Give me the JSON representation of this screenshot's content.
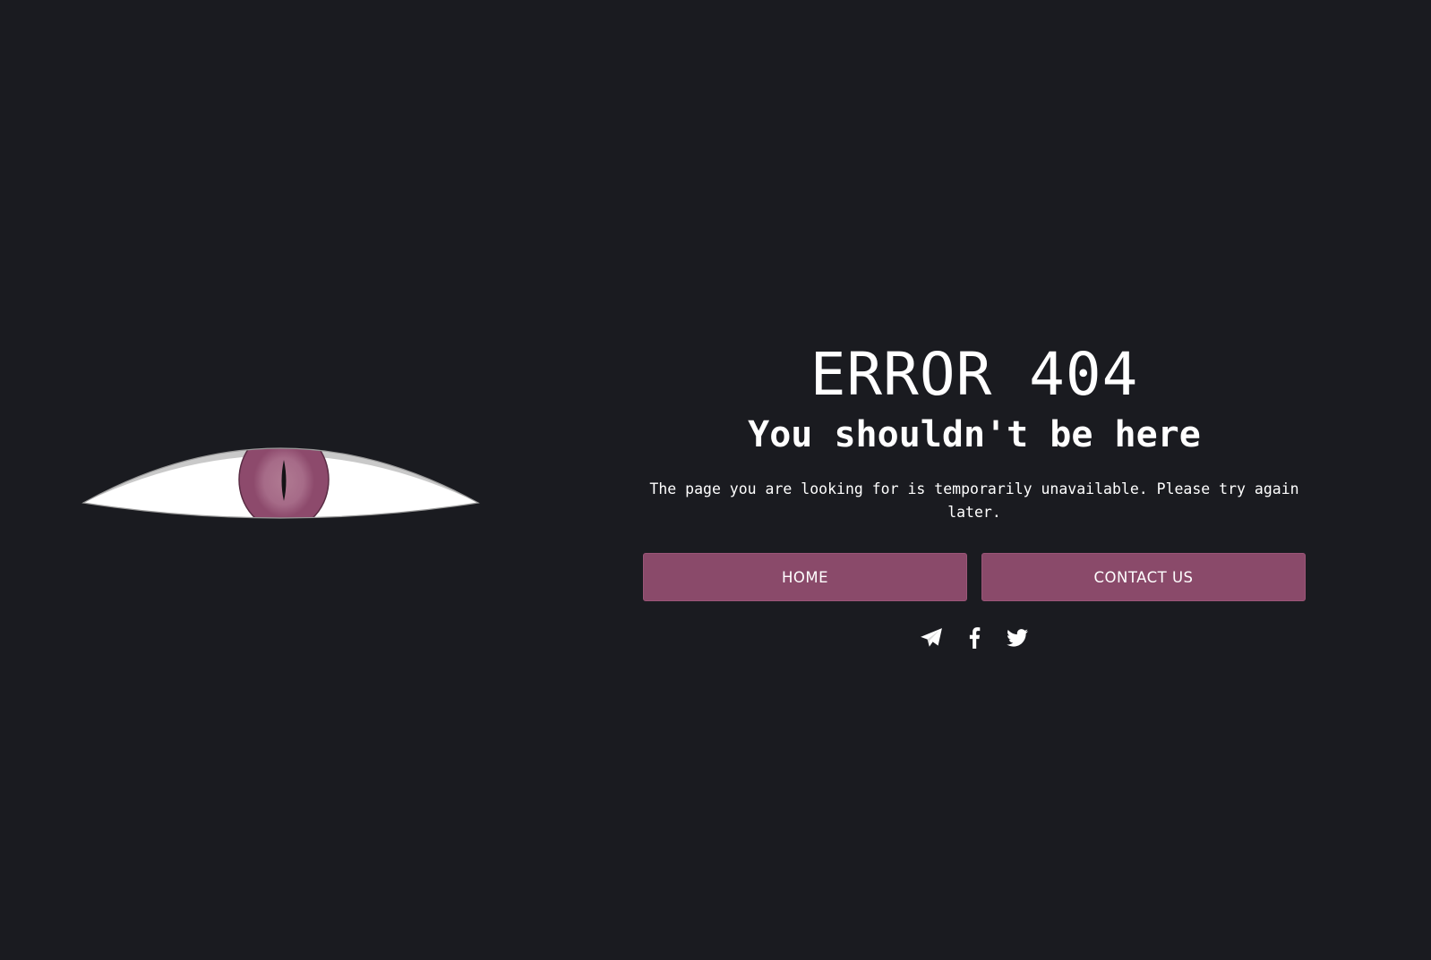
{
  "main": {
    "title": "ERROR 404",
    "subtitle": "You shouldn't be here",
    "message": "The page you are looking for is temporarily unavailable. Please try again later."
  },
  "buttons": {
    "home_label": "HOME",
    "contact_label": "CONTACT US"
  },
  "social": [
    {
      "icon": "telegram-icon"
    },
    {
      "icon": "facebook-icon"
    },
    {
      "icon": "twitter-icon"
    }
  ],
  "colors": {
    "background": "#1a1b20",
    "accent": "#8a4a6a",
    "iris": "#8d4a6c",
    "text": "#ffffff"
  }
}
